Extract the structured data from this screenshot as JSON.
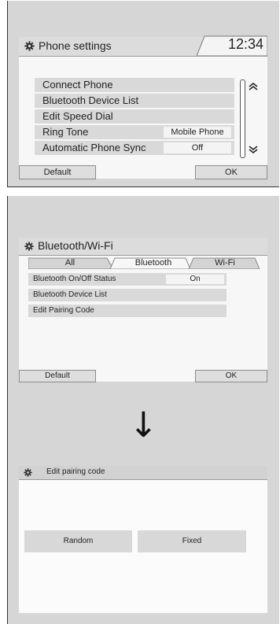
{
  "phone_settings": {
    "title": "Phone settings",
    "clock": "12:34",
    "rows": [
      {
        "label": "Connect Phone",
        "value": ""
      },
      {
        "label": "Bluetooth Device List",
        "value": ""
      },
      {
        "label": "Edit Speed Dial",
        "value": ""
      },
      {
        "label": "Ring Tone",
        "value": "Mobile Phone"
      },
      {
        "label": "Automatic Phone Sync",
        "value": "Off"
      }
    ],
    "up_glyph": "⌃",
    "down_glyph": "⌄",
    "default_label": "Default",
    "ok_label": "OK"
  },
  "bluetooth_wifi": {
    "title": "Bluetooth/Wi-Fi",
    "tabs": [
      "All",
      "Bluetooth",
      "Wi-Fi"
    ],
    "rows": [
      {
        "label": "Bluetooth On/Off Status",
        "value": "On"
      },
      {
        "label": "Bluetooth Device List",
        "value": ""
      },
      {
        "label": "Edit Pairing Code",
        "value": ""
      }
    ],
    "default_label": "Default",
    "ok_label": "OK"
  },
  "arrow": "↓",
  "edit_pairing": {
    "title": "Edit pairing code",
    "random_label": "Random",
    "fixed_label": "Fixed"
  },
  "icons": {
    "gear": "gear-icon",
    "scroll_up": "double-chevron-up-icon",
    "scroll_down": "double-chevron-down-icon",
    "arrow": "down-arrow-icon"
  },
  "colors": {
    "frame_bg": "#d6d6d6",
    "screen_bg": "#f7f7f7",
    "row_bg": "#d9d9d9",
    "header_bg": "#dcdcdc"
  }
}
